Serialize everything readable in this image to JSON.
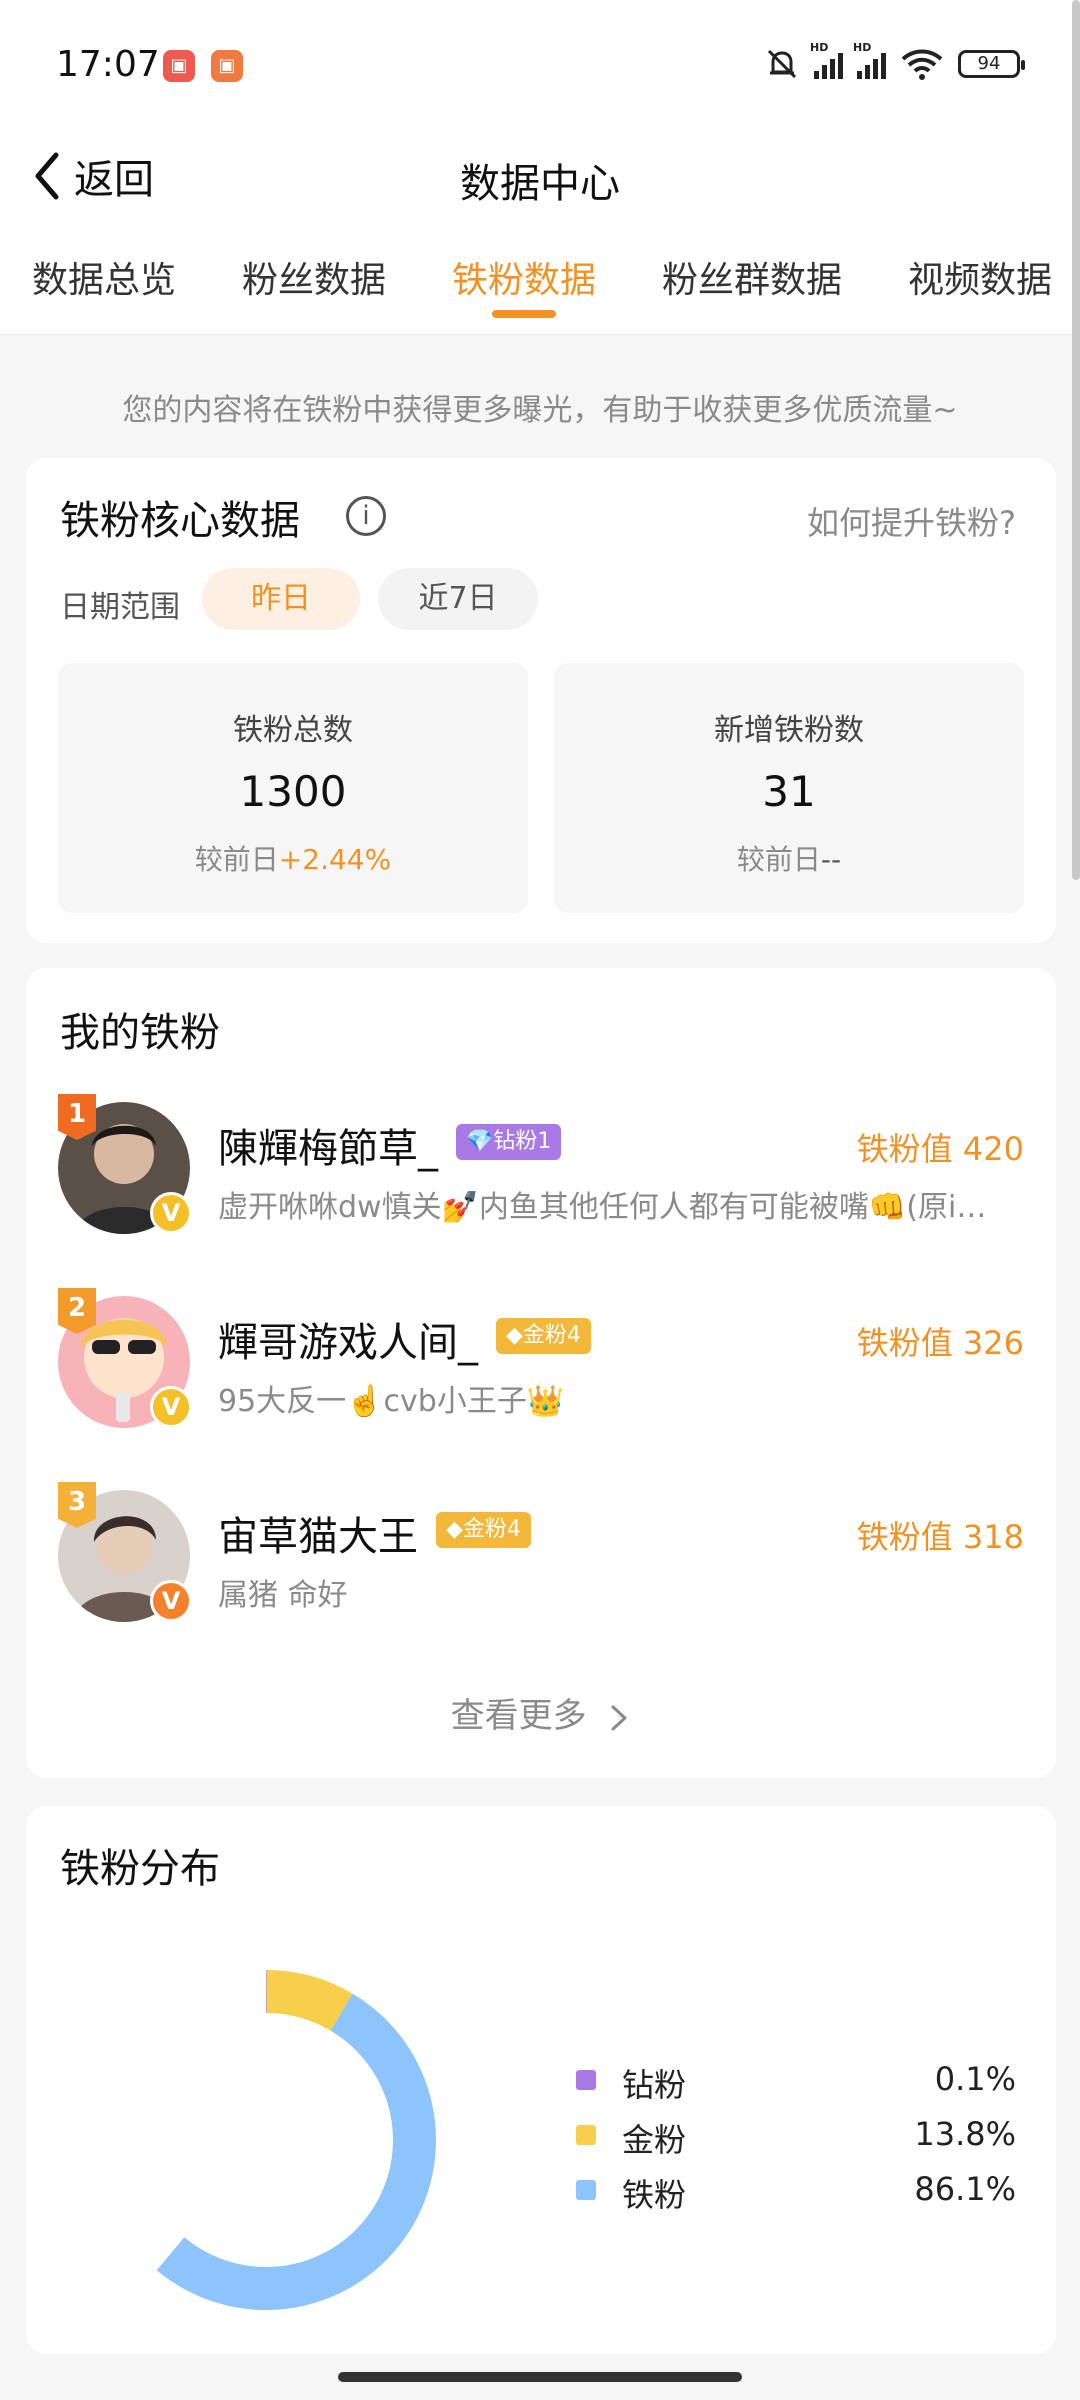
{
  "status_bar": {
    "time": "17:07",
    "battery": "94",
    "icons": [
      "app-icon-1",
      "app-icon-2",
      "mute-bell-icon",
      "signal-hd-icon",
      "signal-hd-icon",
      "wifi-icon",
      "battery-icon"
    ]
  },
  "header": {
    "back_label": "返回",
    "title": "数据中心"
  },
  "tabs": [
    {
      "label": "数据总览"
    },
    {
      "label": "粉丝数据"
    },
    {
      "label": "铁粉数据"
    },
    {
      "label": "粉丝群数据"
    },
    {
      "label": "视频数据"
    }
  ],
  "active_tab": "铁粉数据",
  "hint_text": "您的内容将在铁粉中获得更多曝光，有助于收获更多优质流量~",
  "core": {
    "title": "铁粉核心数据",
    "info_icon": "ⓘ",
    "improve_link": "如何提升铁粉?",
    "date_label": "日期范围",
    "date_options": [
      "昨日",
      "近7日"
    ],
    "selected_date": "昨日",
    "stats": [
      {
        "label": "铁粉总数",
        "value": "1300",
        "compare_prefix": "较前日",
        "compare_value": "+2.44%"
      },
      {
        "label": "新增铁粉数",
        "value": "31",
        "compare_prefix": "较前日",
        "compare_value": "--"
      }
    ]
  },
  "my_fans": {
    "title": "我的铁粉",
    "items": [
      {
        "rank": "1",
        "name": "陳輝梅節草_",
        "badge": "钻粉1",
        "score_label": "铁粉值",
        "score": "420",
        "bio": "虚开咻咻dw慎关💅内鱼其他任何人都有可能被嘴👊(原i…",
        "verified": "V"
      },
      {
        "rank": "2",
        "name": "輝哥游戏人间_",
        "badge": "金粉4",
        "score_label": "铁粉值",
        "score": "326",
        "bio": "95大反一☝️cvb小王子👑",
        "verified": "V"
      },
      {
        "rank": "3",
        "name": "宙草猫大王",
        "badge": "金粉4",
        "score_label": "铁粉值",
        "score": "318",
        "bio": "属猪 命好",
        "verified": "V"
      }
    ],
    "more_label": "查看更多"
  },
  "distribution": {
    "title": "铁粉分布",
    "colors": {
      "diamond": "#a97ae6",
      "gold": "#f8cf4a",
      "iron": "#8cc4fb"
    }
  },
  "chart_data": {
    "type": "pie",
    "categories": [
      "钻粉",
      "金粉",
      "铁粉"
    ],
    "values": [
      0.1,
      13.8,
      86.1
    ],
    "value_labels": [
      "0.1%",
      "13.8%",
      "86.1%"
    ],
    "colors": [
      "#a97ae6",
      "#f8cf4a",
      "#8cc4fb"
    ],
    "legend_position": "right"
  }
}
